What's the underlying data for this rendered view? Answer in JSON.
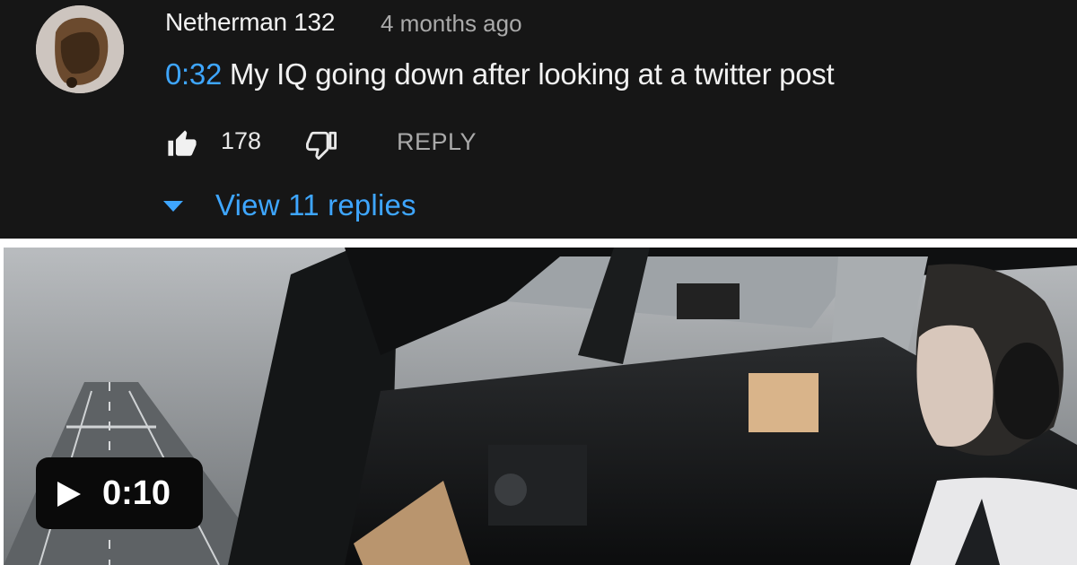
{
  "comment": {
    "author": "Netherman 132",
    "time": "4 months ago",
    "timestamp": "0:32",
    "text": " My IQ going down after looking at a twitter post",
    "likes": "178",
    "reply_label": "REPLY",
    "view_replies_label": "View 11 replies"
  },
  "video": {
    "duration": "0:10"
  },
  "icons": {
    "like": "thumbs-up-icon",
    "dislike": "thumbs-down-icon",
    "expand": "caret-down-icon",
    "play": "play-icon"
  },
  "colors": {
    "background": "#161616",
    "link": "#3ea6ff",
    "text": "#f1f1f1",
    "muted": "#aaaaaa"
  }
}
